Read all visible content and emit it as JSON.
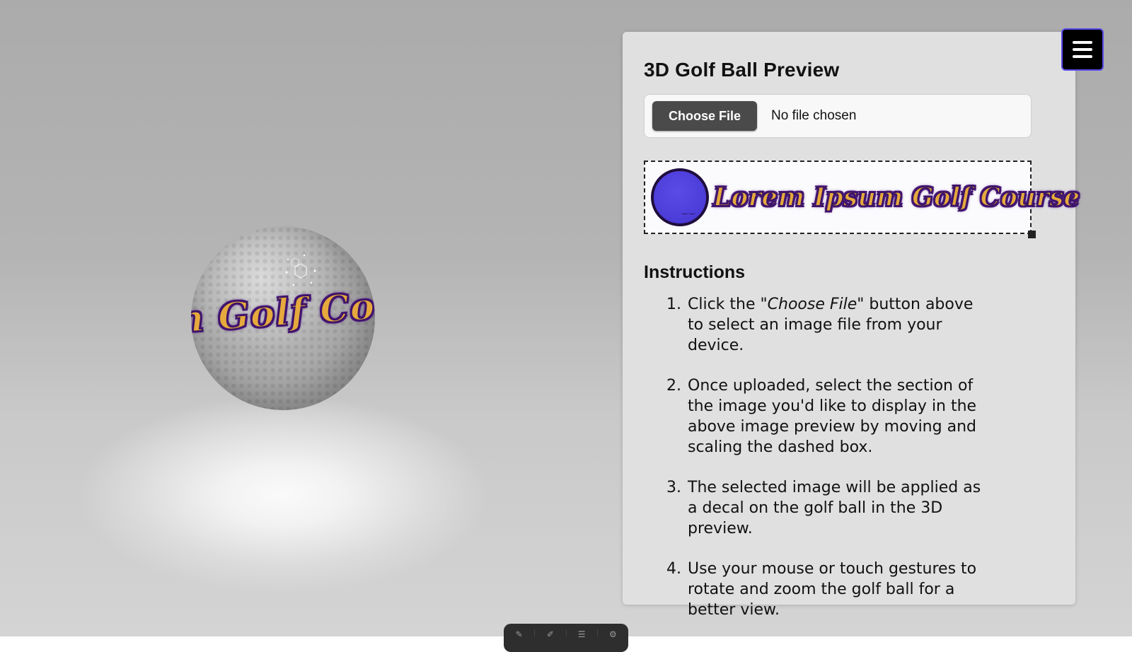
{
  "panel": {
    "title": "3D Golf Ball Preview",
    "file_input": {
      "button_label": "Choose File",
      "status": "No file chosen"
    },
    "decal_preview": {
      "text": "Lorem Ipsum Golf Course",
      "logo_icon": "golf-ball-logo"
    },
    "instructions": {
      "title": "Instructions",
      "steps": [
        {
          "before": "Click the \"",
          "emphasis": "Choose File",
          "after": "\" button above to select an image file from your device."
        },
        {
          "text": "Once uploaded, select the section of the image you'd like to display in the above image preview by moving and scaling the dashed box."
        },
        {
          "text": "The selected image will be applied as a decal on the golf ball in the 3D preview."
        },
        {
          "text": "Use your mouse or touch gestures to rotate and zoom the golf ball for a better view."
        }
      ]
    }
  },
  "scene": {
    "ball_decal_text": "n Golf Course"
  },
  "menu_button": {
    "icon": "hamburger-icon"
  },
  "colors": {
    "decal_fill": "#e6a93d",
    "decal_outline": "#3a1465",
    "logo_blue": "#4b3cd8",
    "panel_bg": "#e0e0e0",
    "menu_border": "#5a4be6"
  }
}
